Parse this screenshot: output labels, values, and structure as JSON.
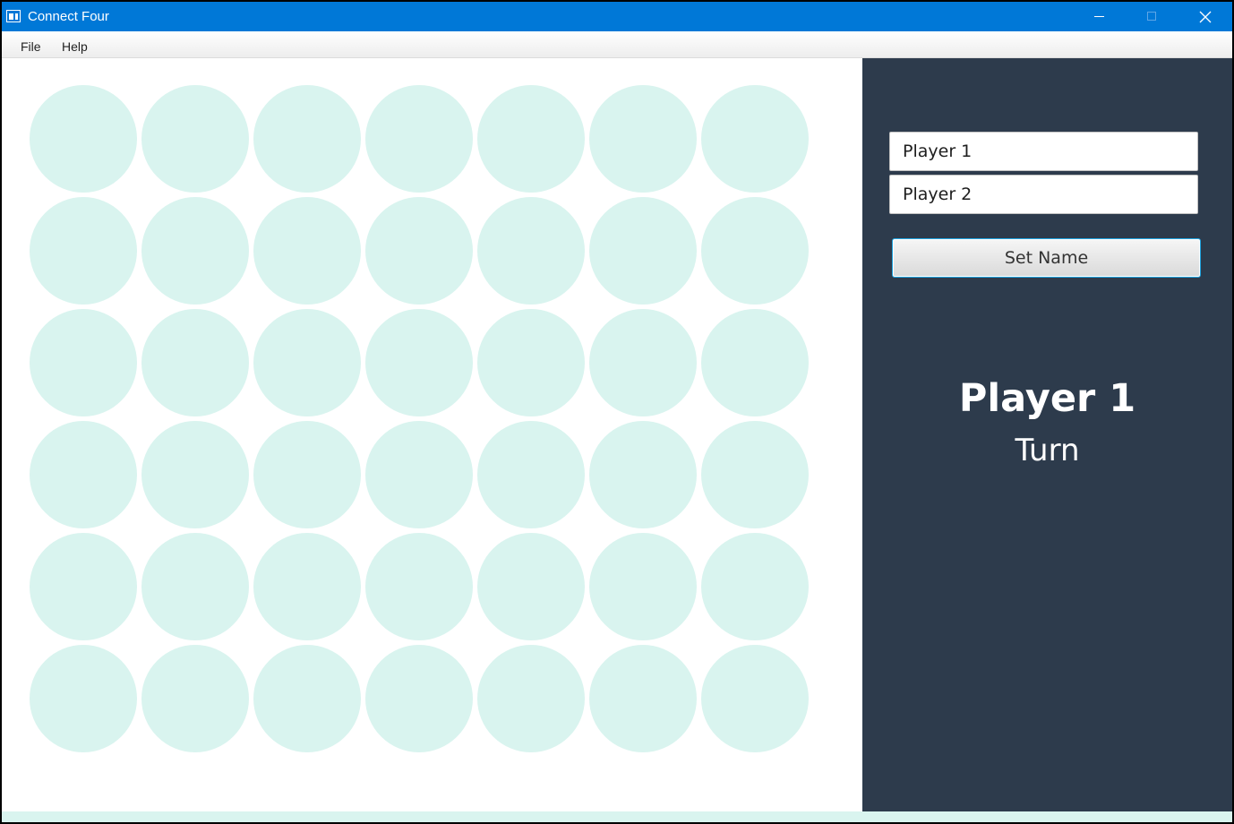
{
  "window": {
    "title": "Connect Four",
    "icon": "window-icon",
    "controls": [
      "minimize-icon",
      "maximize-icon",
      "close-icon"
    ]
  },
  "menu": {
    "items": [
      {
        "label": "File"
      },
      {
        "label": "Help"
      }
    ]
  },
  "board": {
    "rows": 6,
    "columns": 7,
    "empty_cell_color": "#d9f4ef"
  },
  "panel": {
    "player1_value": "Player 1",
    "player2_value": "Player 2",
    "set_name_label": "Set Name",
    "current_player": "Player 1",
    "turn_label": "Turn",
    "background": "#2d3b4c"
  },
  "colors": {
    "titlebar": "#0078d7",
    "accent": "#1fa4e0"
  }
}
